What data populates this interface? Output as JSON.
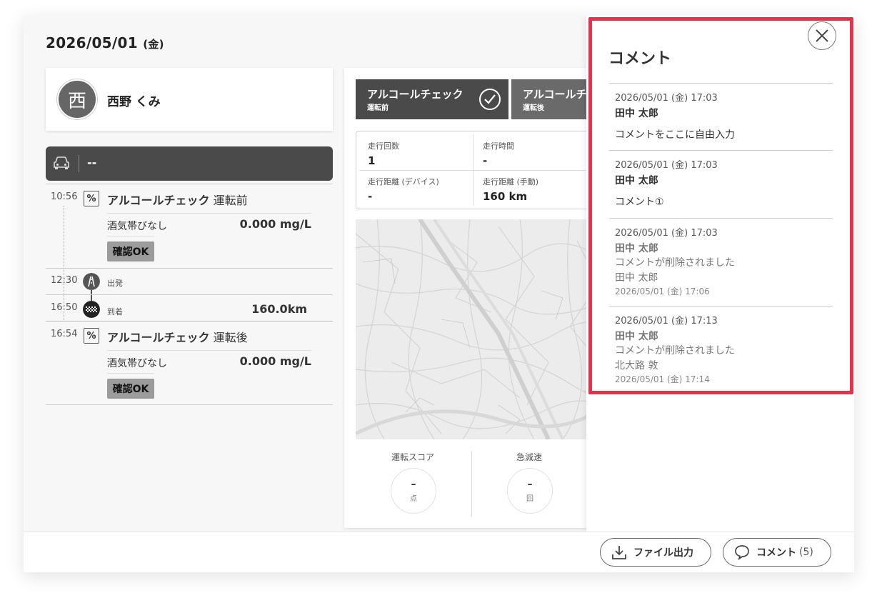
{
  "header": {
    "date": "2026/05/01",
    "dow": "(金)"
  },
  "driver": {
    "avatar_char": "西",
    "name": "西野 くみ"
  },
  "vehicle": {
    "plate": "--"
  },
  "timeline": {
    "check_before": {
      "time": "10:56",
      "icon": "%",
      "title": "アルコールチェック",
      "suffix": "運転前",
      "label": "酒気帯びなし",
      "value": "0.000 mg/L",
      "badge": "確認OK"
    },
    "depart": {
      "time": "12:30",
      "label": "出発"
    },
    "arrive": {
      "time": "16:50",
      "label": "到着",
      "distance": "160.0km"
    },
    "check_after": {
      "time": "16:54",
      "icon": "%",
      "title": "アルコールチェック",
      "suffix": "運転後",
      "label": "酒気帯びなし",
      "value": "0.000 mg/L",
      "badge": "確認OK"
    }
  },
  "alcohol_tabs": [
    {
      "title": "アルコールチェック",
      "sub": "運転前"
    },
    {
      "title": "アルコールチェック",
      "sub": "運転後"
    }
  ],
  "stats": {
    "runs_label": "走行回数",
    "runs_value": "1",
    "time_label": "走行時間",
    "time_value": "-",
    "dist_dev_label": "走行距離 (デバイス)",
    "dist_dev_value": "-",
    "dist_man_label": "走行距離 (手動)",
    "dist_man_value": "160 km"
  },
  "scores": [
    {
      "label": "運転スコア",
      "value": "–",
      "unit": "点"
    },
    {
      "label": "急減速",
      "value": "–",
      "unit": "回"
    }
  ],
  "comments_panel": {
    "title": "コメント",
    "items": [
      {
        "date": "2026/05/01 (金) 17:03",
        "author": "田中 太郎",
        "text": "コメントをここに自由入力"
      },
      {
        "date": "2026/05/01 (金) 17:03",
        "author": "田中 太郎",
        "text": "コメント①"
      },
      {
        "date": "2026/05/01 (金) 17:03",
        "author": "田中 太郎",
        "text": "コメントが削除されました",
        "deleted_by": "田中 太郎",
        "deleted_at": "2026/05/01 (金) 17:06"
      },
      {
        "date": "2026/05/01 (金) 17:13",
        "author": "田中 太郎",
        "text": "コメントが削除されました",
        "deleted_by": "北大路 敦",
        "deleted_at": "2026/05/01 (金) 17:14"
      }
    ]
  },
  "footer": {
    "export_label": "ファイル出力",
    "comment_label": "コメント",
    "comment_count": "(5)"
  },
  "colors": {
    "highlight": "#e0334c",
    "dark": "#4a4a4a",
    "badge": "#9b9b9b"
  }
}
